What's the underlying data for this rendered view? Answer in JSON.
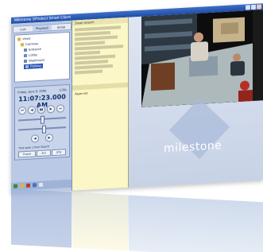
{
  "window": {
    "title": "Milestone XProtect Smart Client",
    "accent": "#2a57b5"
  },
  "left_panel": {
    "toolbar_tabs": [
      "Live",
      "Playback",
      "Setup"
    ],
    "tree": {
      "items": [
        "Views",
        "Cameras",
        "Entrance",
        "Lobby",
        "Warehouse",
        "Parking"
      ],
      "selected_index": 5
    },
    "playback": {
      "date": "Friday, June 9, 2006",
      "speed": "1.00x",
      "time": "11:07:23.000 AM",
      "transport_buttons": [
        "⏮",
        "◀",
        "▮▮",
        "▶",
        "⏭"
      ],
      "jog_buttons": [
        "◀",
        "▶"
      ],
      "range_label": "Time span 1 hour Search",
      "export_buttons": [
        "Export",
        "AVI",
        "JPG"
      ]
    }
  },
  "middle_panel": {
    "header": "Smart Search",
    "sub_header": "Alarm list"
  },
  "video_area": {
    "logo_text": "milestone",
    "scene_colors": {
      "floor": "#b8c4c6",
      "shelving": "#4a5a66",
      "crate": "#7c4a2a",
      "boxes": "#c9b48a",
      "shirt": "#d4d0c6",
      "person_red": "#b53024"
    }
  }
}
